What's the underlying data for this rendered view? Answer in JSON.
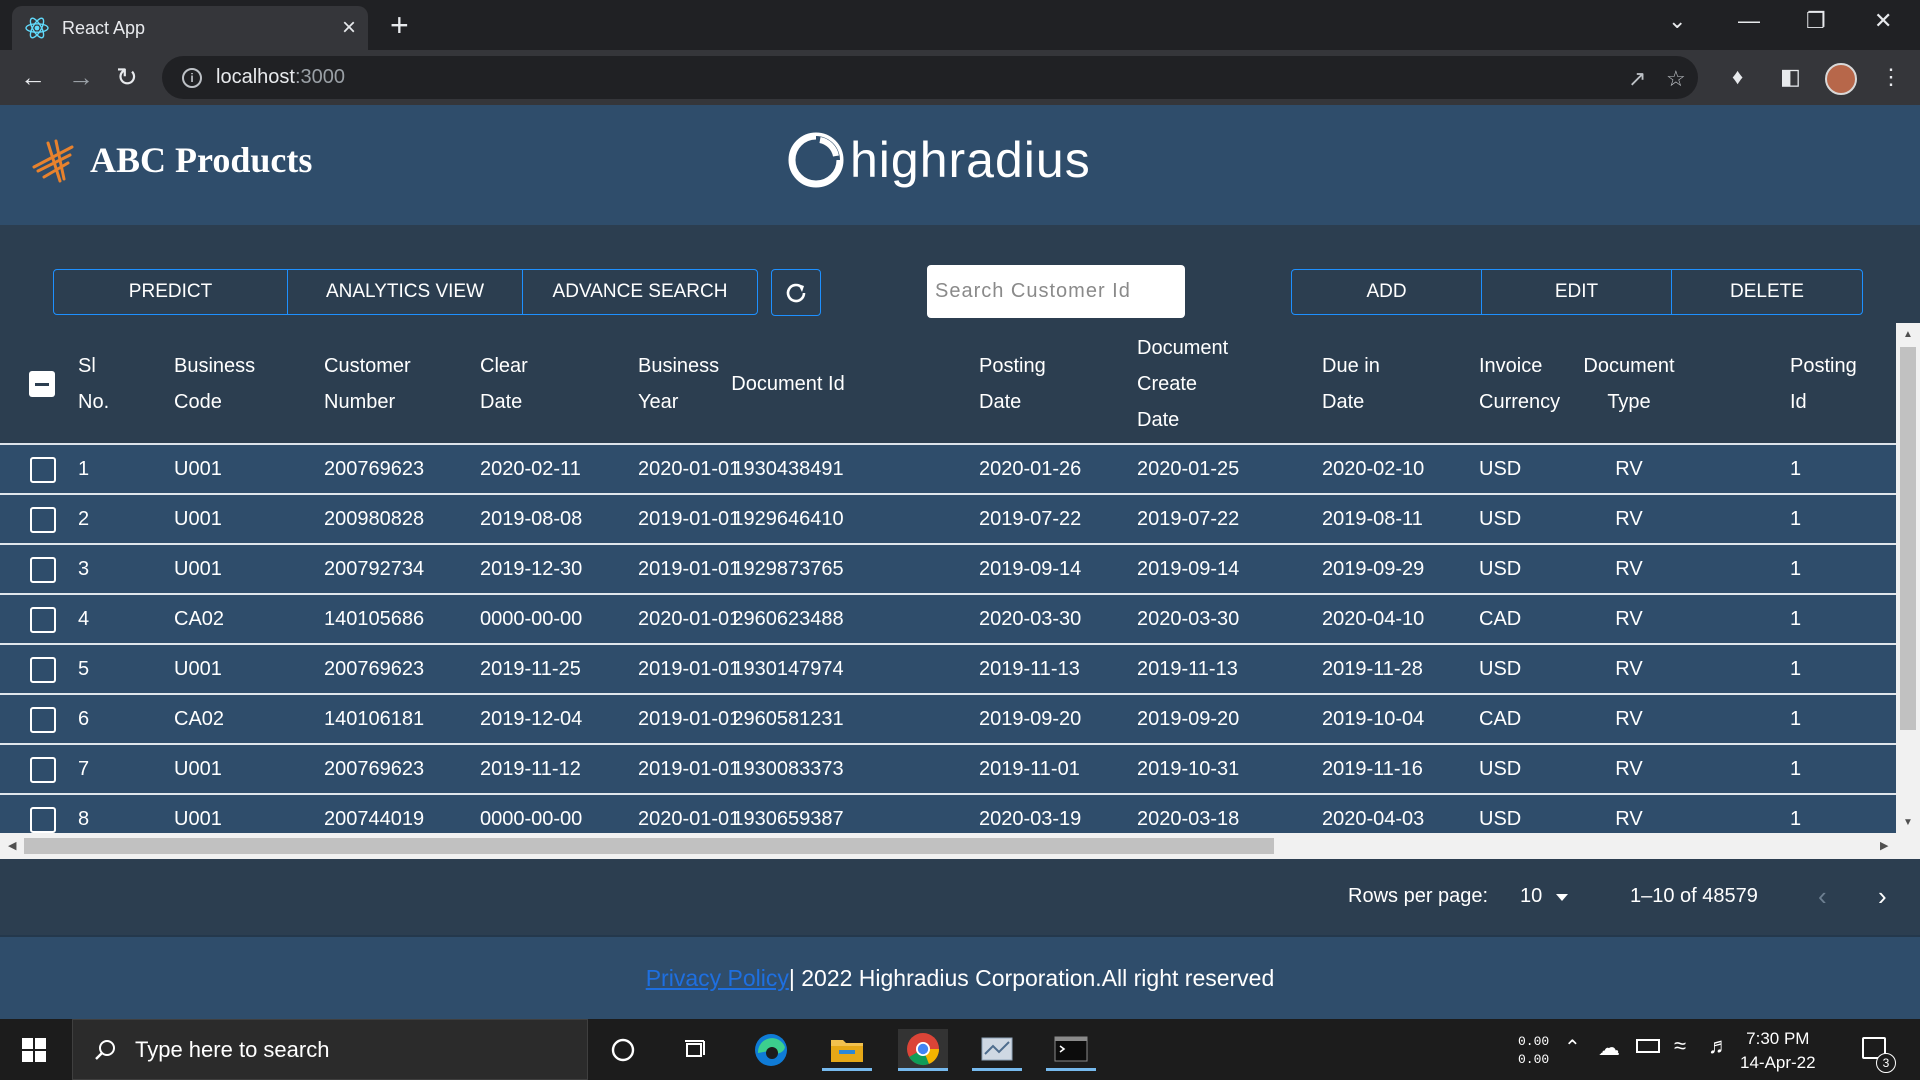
{
  "browser": {
    "tab_title": "React App",
    "tab_close": "×",
    "new_tab": "+",
    "url_host": "localhost",
    "url_port": ":3000"
  },
  "header": {
    "brand_name": "ABC Products",
    "partner_logo": "highradius"
  },
  "toolbar": {
    "left_buttons": [
      "PREDICT",
      "ANALYTICS VIEW",
      "ADVANCE SEARCH"
    ],
    "right_buttons": [
      "ADD",
      "EDIT",
      "DELETE"
    ],
    "search_placeholder": "Search Customer Id",
    "accent_color": "#1e90ff"
  },
  "table": {
    "columns": [
      [
        "Sl",
        "No."
      ],
      [
        "Business",
        "Code"
      ],
      [
        "Customer",
        "Number"
      ],
      [
        "Clear",
        "Date"
      ],
      [
        "Business",
        "Year"
      ],
      [
        "Document Id"
      ],
      [
        "Posting",
        "Date"
      ],
      [
        "Document",
        "Create",
        "Date"
      ],
      [
        "Due in",
        "Date"
      ],
      [
        "Invoice",
        "Currency"
      ],
      [
        "Document",
        "Type"
      ],
      [
        "Posting",
        "Id"
      ]
    ],
    "rows": [
      [
        "1",
        "U001",
        "200769623",
        "2020-02-11",
        "2020-01-01",
        "1930438491",
        "2020-01-26",
        "2020-01-25",
        "2020-02-10",
        "USD",
        "RV",
        "1"
      ],
      [
        "2",
        "U001",
        "200980828",
        "2019-08-08",
        "2019-01-01",
        "1929646410",
        "2019-07-22",
        "2019-07-22",
        "2019-08-11",
        "USD",
        "RV",
        "1"
      ],
      [
        "3",
        "U001",
        "200792734",
        "2019-12-30",
        "2019-01-01",
        "1929873765",
        "2019-09-14",
        "2019-09-14",
        "2019-09-29",
        "USD",
        "RV",
        "1"
      ],
      [
        "4",
        "CA02",
        "140105686",
        "0000-00-00",
        "2020-01-01",
        "2960623488",
        "2020-03-30",
        "2020-03-30",
        "2020-04-10",
        "CAD",
        "RV",
        "1"
      ],
      [
        "5",
        "U001",
        "200769623",
        "2019-11-25",
        "2019-01-01",
        "1930147974",
        "2019-11-13",
        "2019-11-13",
        "2019-11-28",
        "USD",
        "RV",
        "1"
      ],
      [
        "6",
        "CA02",
        "140106181",
        "2019-12-04",
        "2019-01-01",
        "2960581231",
        "2019-09-20",
        "2019-09-20",
        "2019-10-04",
        "CAD",
        "RV",
        "1"
      ],
      [
        "7",
        "U001",
        "200769623",
        "2019-11-12",
        "2019-01-01",
        "1930083373",
        "2019-11-01",
        "2019-10-31",
        "2019-11-16",
        "USD",
        "RV",
        "1"
      ],
      [
        "8",
        "U001",
        "200744019",
        "0000-00-00",
        "2020-01-01",
        "1930659387",
        "2020-03-19",
        "2020-03-18",
        "2020-04-03",
        "USD",
        "RV",
        "1"
      ]
    ]
  },
  "pagination": {
    "rows_per_page_label": "Rows per page:",
    "rows_per_page_value": "10",
    "range_text": "1–10 of 48579"
  },
  "footer": {
    "privacy_link": "Privacy Policy",
    "copyright": "| 2022 Highradius Corporation.All right reserved"
  },
  "taskbar": {
    "search_placeholder": "Type here to search",
    "net_up": "0.00",
    "net_down": "0.00",
    "time": "7:30 PM",
    "date": "14-Apr-22",
    "notification_count": "3"
  },
  "colors": {
    "page_bg": "#2c3e50",
    "row_bg": "#2f4d6b",
    "brand_orange": "#e8822d"
  }
}
